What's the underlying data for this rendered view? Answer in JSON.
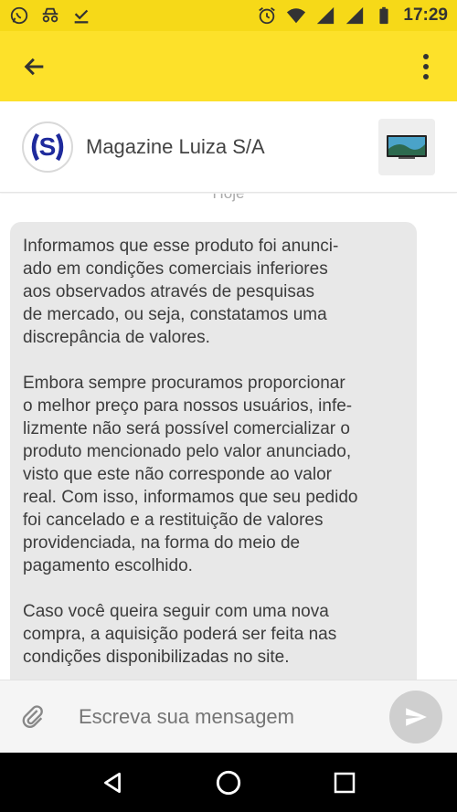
{
  "status_bar": {
    "time": "17:29",
    "left_icons": [
      "whatsapp-icon",
      "incognito-icon",
      "download-done-icon"
    ],
    "right_icons": [
      "alarm-icon",
      "wifi-icon",
      "signal-icon",
      "signal-icon",
      "battery-icon"
    ]
  },
  "app_bar": {
    "back_icon": "arrow-back-icon",
    "menu_icon": "more-vert-icon",
    "color": "#fde12a"
  },
  "header": {
    "logo_letter": "S",
    "store_name": "Magazine Luiza S/A",
    "product_icon": "tv-thumbnail"
  },
  "chat": {
    "date_label": "Hoje",
    "message_paragraphs": [
      [
        "Informamos que esse produto foi anunci-",
        "ado em condições comerciais inferiores",
        "aos observados através de pesquisas",
        "de mercado, ou seja, constatamos uma",
        "discrepância de valores."
      ],
      [
        "Embora sempre procuramos proporcionar",
        "o melhor preço para nossos usuários, infe-",
        "lizmente não será possível comercializar o",
        "produto mencionado pelo valor anunciado,",
        "visto que este não corresponde ao valor",
        "real. Com isso, informamos que seu pedido",
        "foi cancelado e a restituição de valores",
        "providenciada, na forma do meio de",
        "pagamento escolhido."
      ],
      [
        "Caso você queira seguir com uma nova",
        "compra, a aquisição poderá ser feita nas",
        "condições disponibilizadas no site."
      ]
    ]
  },
  "composer": {
    "placeholder": "Escreva sua mensagem",
    "attach_icon": "paperclip-icon",
    "send_icon": "send-icon"
  },
  "nav_bar": {
    "buttons": [
      "back-triangle-icon",
      "home-circle-icon",
      "recents-square-icon"
    ]
  }
}
